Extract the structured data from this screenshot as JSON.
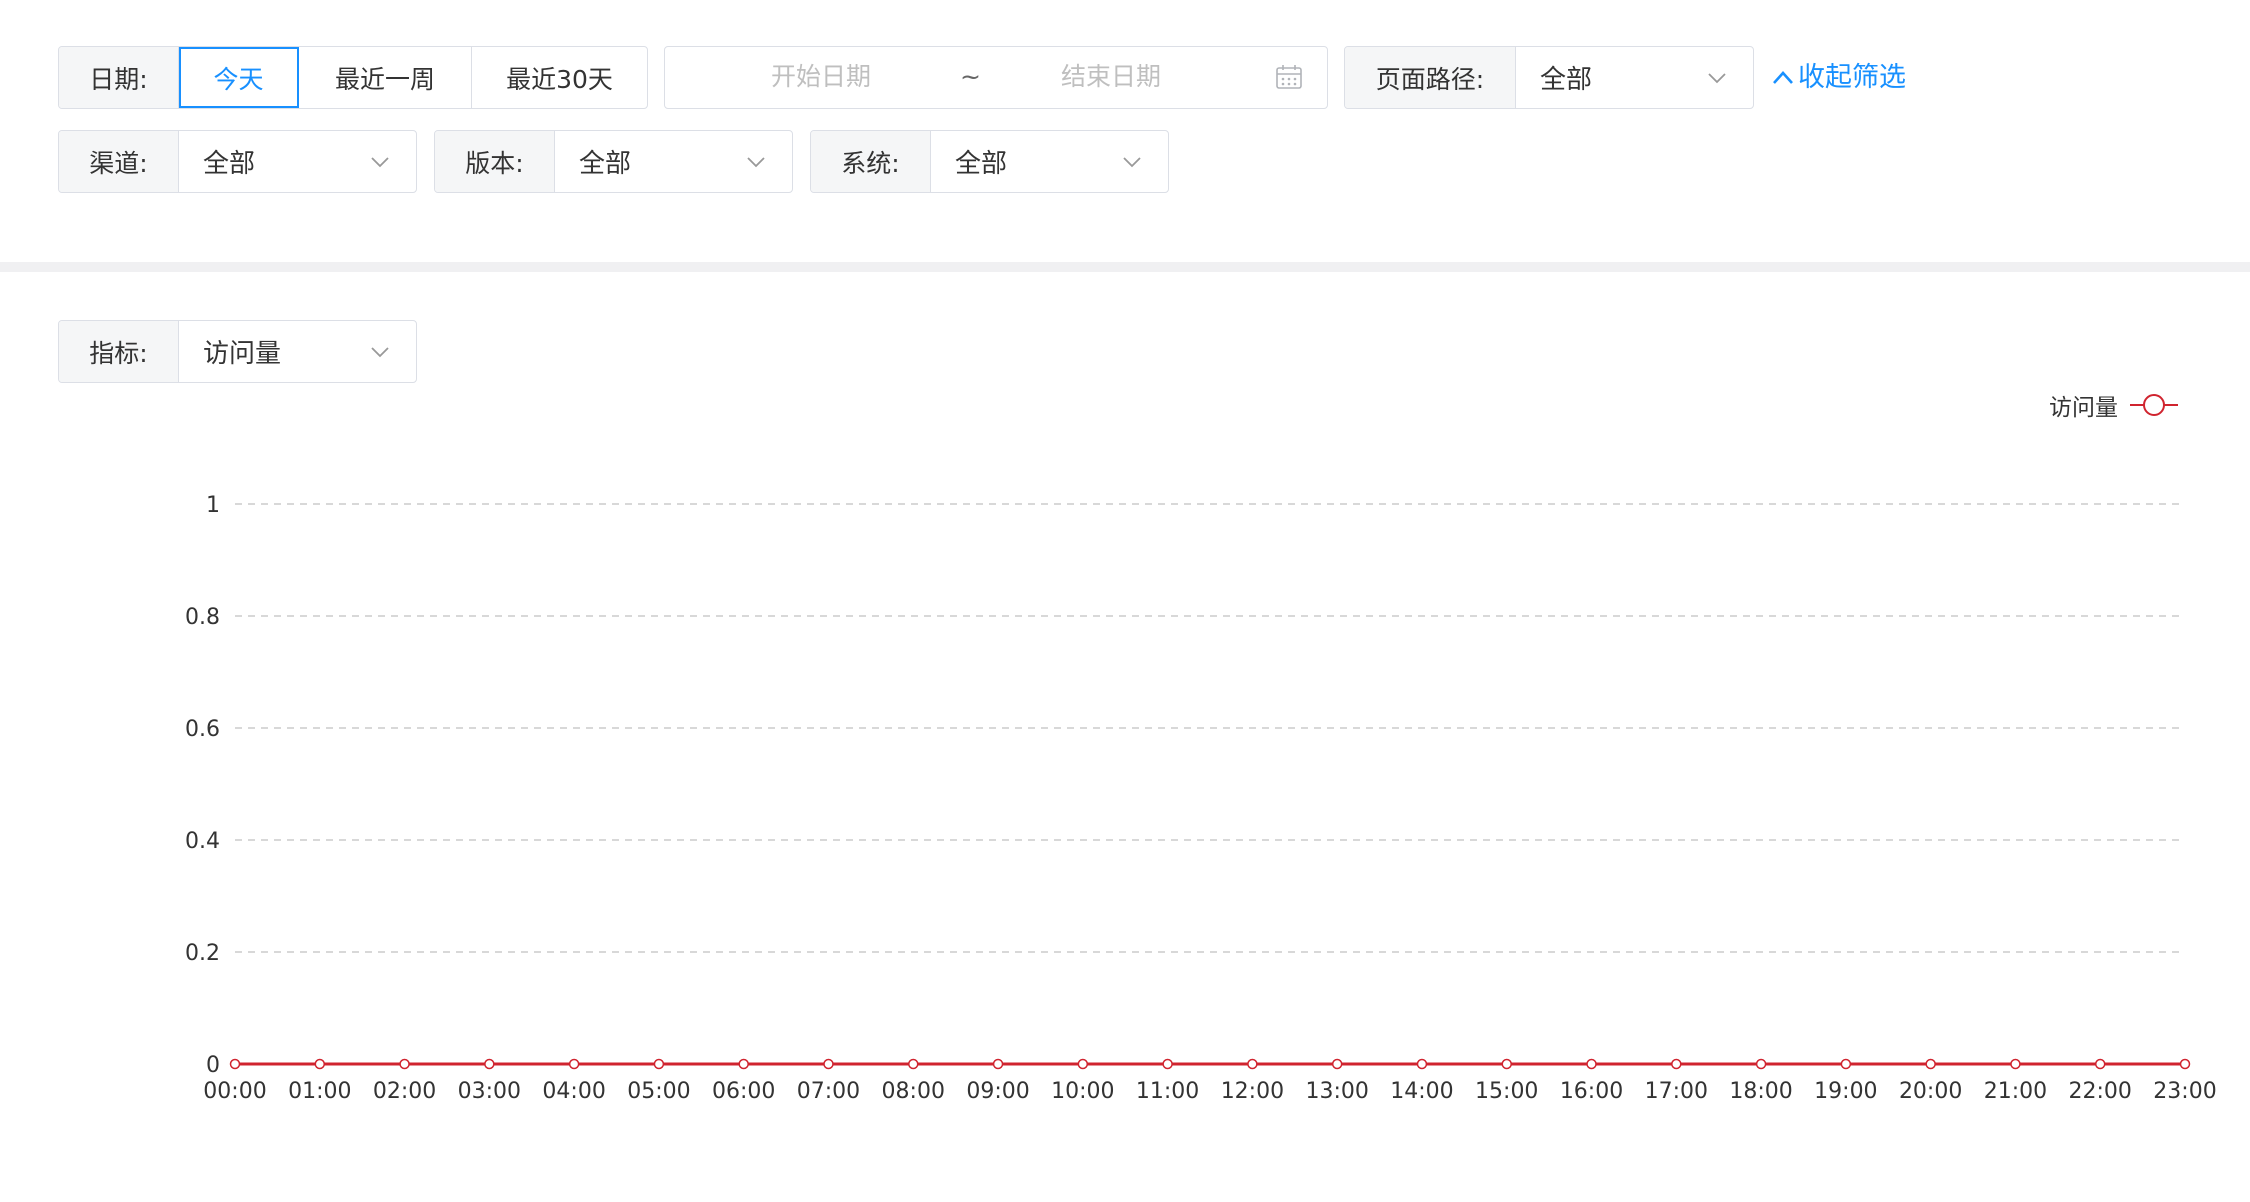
{
  "filters": {
    "date": {
      "label": "日期:",
      "options": [
        "今天",
        "最近一周",
        "最近30天"
      ],
      "selected": "今天"
    },
    "daterange": {
      "start_placeholder": "开始日期",
      "separator": "~",
      "end_placeholder": "结束日期",
      "icon": "calendar-icon"
    },
    "page_path": {
      "label": "页面路径:",
      "value": "全部"
    },
    "collapse_label": "收起筛选",
    "channel": {
      "label": "渠道:",
      "value": "全部"
    },
    "version": {
      "label": "版本:",
      "value": "全部"
    },
    "system": {
      "label": "系统:",
      "value": "全部"
    }
  },
  "metric": {
    "label": "指标:",
    "value": "访问量"
  },
  "colors": {
    "accent": "#1890ff",
    "series": "#d0242f",
    "grid": "#cccccc",
    "panel_band": "#f0f0f2"
  },
  "chart_data": {
    "type": "line",
    "categories": [
      "00:00",
      "01:00",
      "02:00",
      "03:00",
      "04:00",
      "05:00",
      "06:00",
      "07:00",
      "08:00",
      "09:00",
      "10:00",
      "11:00",
      "12:00",
      "13:00",
      "14:00",
      "15:00",
      "16:00",
      "17:00",
      "18:00",
      "19:00",
      "20:00",
      "21:00",
      "22:00",
      "23:00"
    ],
    "series": [
      {
        "name": "访问量",
        "values": [
          0,
          0,
          0,
          0,
          0,
          0,
          0,
          0,
          0,
          0,
          0,
          0,
          0,
          0,
          0,
          0,
          0,
          0,
          0,
          0,
          0,
          0,
          0,
          0
        ]
      }
    ],
    "yticks": [
      "0",
      "0.2",
      "0.4",
      "0.6",
      "0.8",
      "1"
    ],
    "ylim": [
      0,
      1
    ],
    "grid": true,
    "legend_position": "top-right"
  }
}
